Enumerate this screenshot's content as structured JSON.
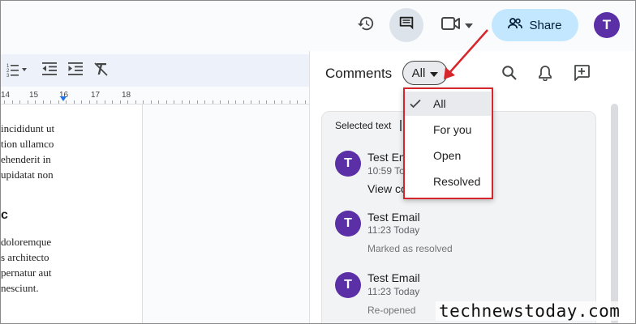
{
  "header": {
    "share_label": "Share",
    "avatar_initial": "T",
    "icons": [
      "history-icon",
      "comments-icon",
      "video-call-icon",
      "people-icon"
    ]
  },
  "toolbar": {
    "icons": [
      "numbered-list-icon",
      "decrease-indent-icon",
      "increase-indent-icon",
      "clear-formatting-icon"
    ]
  },
  "ruler": {
    "numbers": [
      "14",
      "15",
      "16",
      "17",
      "18"
    ]
  },
  "document": {
    "paragraph1": [
      "incididunt ut",
      "tion ullamco",
      "ehenderit in",
      "upidatat non"
    ],
    "heading": "c",
    "paragraph2": [
      "doloremque",
      "s architecto",
      "pernatur aut",
      "nesciunt."
    ]
  },
  "comments_panel": {
    "title": "Comments",
    "filter_value": "All",
    "selected_text_label": "Selected text",
    "comments": [
      {
        "author": "Test Em",
        "time": "10:59 Toda",
        "body": "View co",
        "avatar": "T"
      },
      {
        "author": "Test Email",
        "time": "11:23 Today",
        "note": "Marked as resolved",
        "avatar": "T"
      },
      {
        "author": "Test Email",
        "time": "11:23 Today",
        "note": "Re-opened",
        "avatar": "T"
      }
    ]
  },
  "filter_dropdown": {
    "options": [
      "All",
      "For you",
      "Open",
      "Resolved"
    ],
    "selected": "All"
  },
  "watermark": "technewstoday.com",
  "colors": {
    "accent_red": "#d7262b",
    "share_bg": "#c2e7ff",
    "avatar_purple": "#5b2fa6"
  }
}
